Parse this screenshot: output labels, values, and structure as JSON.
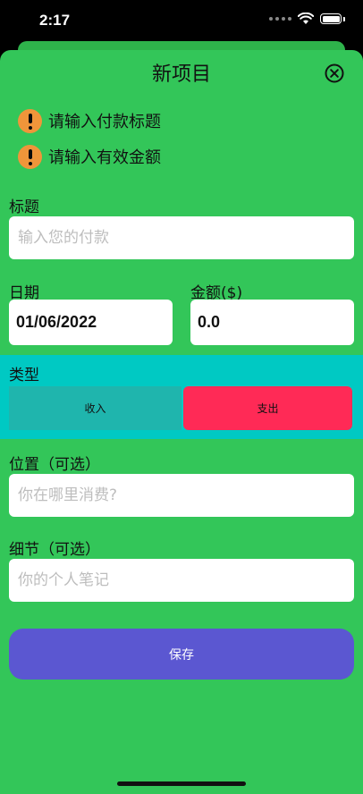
{
  "status": {
    "time": "2:17"
  },
  "header": {
    "title": "新项目"
  },
  "errors": [
    "请输入付款标题",
    "请输入有效金额"
  ],
  "form": {
    "title_label": "标题",
    "title_placeholder": "输入您的付款",
    "date_label": "日期",
    "date_value": "01/06/2022",
    "amount_label": "金额($)",
    "amount_value": "0.0",
    "type_label": "类型",
    "type_options": [
      "收入",
      "支出"
    ],
    "type_selected": "支出",
    "location_label": "位置（可选）",
    "location_placeholder": "你在哪里消费?",
    "details_label": "细节（可选）",
    "details_placeholder": "你的个人笔记"
  },
  "save_label": "保存",
  "colors": {
    "sheet_bg": "#33c659",
    "type_panel_bg": "#00c9c3",
    "income_bg": "#1fb5ad",
    "expense_bg": "#ff2a56",
    "save_bg": "#5b57d1",
    "warning": "#f0953a"
  }
}
